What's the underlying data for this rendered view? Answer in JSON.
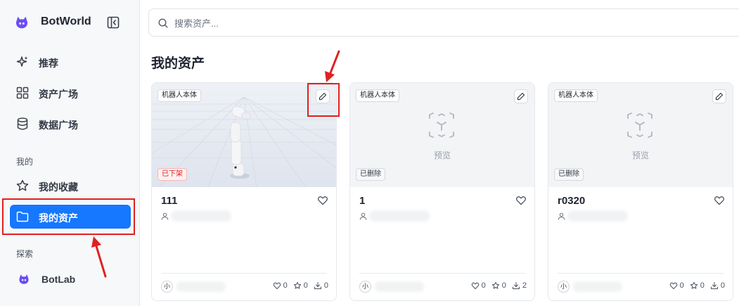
{
  "brand": {
    "name": "BotWorld",
    "accent": "#1677ff",
    "logo_color": "#6c4df6"
  },
  "sidebar": {
    "top_items": [
      {
        "label": "推荐",
        "icon": "sparkle-icon"
      },
      {
        "label": "资产广场",
        "icon": "grid-icon"
      },
      {
        "label": "数据广场",
        "icon": "database-icon"
      }
    ],
    "section_mine": "我的",
    "mine_items": [
      {
        "label": "我的收藏",
        "icon": "star-icon"
      },
      {
        "label": "我的资产",
        "icon": "folder-icon",
        "active": true
      }
    ],
    "section_explore": "探索",
    "explore_items": [
      {
        "label": "BotLab",
        "icon": "botlab-logo-icon"
      }
    ]
  },
  "search": {
    "placeholder": "搜索资产..."
  },
  "main": {
    "title": "我的资产"
  },
  "cards": [
    {
      "type_badge": "机器人本体",
      "status": "已下架",
      "status_kind": "off",
      "title": "111",
      "has_preview_image": true,
      "avatar": "小",
      "stats": {
        "likes": "0",
        "stars": "0",
        "downloads": "0"
      }
    },
    {
      "type_badge": "机器人本体",
      "status": "已删除",
      "status_kind": "deleted",
      "preview_label": "预览",
      "title": "1",
      "avatar": "小",
      "stats": {
        "likes": "0",
        "stars": "0",
        "downloads": "2"
      }
    },
    {
      "type_badge": "机器人本体",
      "status": "已删除",
      "status_kind": "deleted",
      "preview_label": "预览",
      "title": "r0320",
      "avatar": "小",
      "stats": {
        "likes": "0",
        "stars": "0",
        "downloads": "0"
      }
    }
  ],
  "annotations": {
    "color": "#e02020"
  }
}
